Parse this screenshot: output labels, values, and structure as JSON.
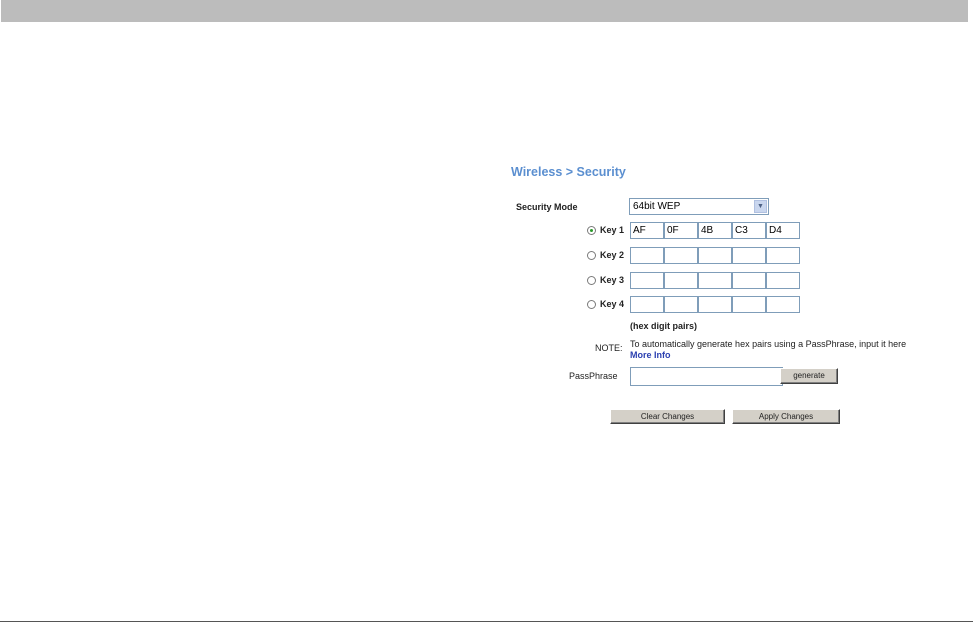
{
  "page": {
    "title": "Wireless > Security"
  },
  "security_mode": {
    "label": "Security Mode",
    "value": "64bit WEP"
  },
  "keys": [
    {
      "label": "Key 1",
      "selected": true,
      "values": [
        "AF",
        "0F",
        "4B",
        "C3",
        "D4"
      ]
    },
    {
      "label": "Key 2",
      "selected": false,
      "values": [
        "",
        "",
        "",
        "",
        ""
      ]
    },
    {
      "label": "Key 3",
      "selected": false,
      "values": [
        "",
        "",
        "",
        "",
        ""
      ]
    },
    {
      "label": "Key 4",
      "selected": false,
      "values": [
        "",
        "",
        "",
        "",
        ""
      ]
    }
  ],
  "hint": "(hex digit pairs)",
  "note": {
    "label": "NOTE:",
    "text": "To automatically generate hex pairs using a PassPhrase, input it here",
    "link": "More Info"
  },
  "passphrase": {
    "label": "PassPhrase",
    "value": "",
    "button": "generate"
  },
  "actions": {
    "clear": "Clear Changes",
    "apply": "Apply Changes"
  }
}
